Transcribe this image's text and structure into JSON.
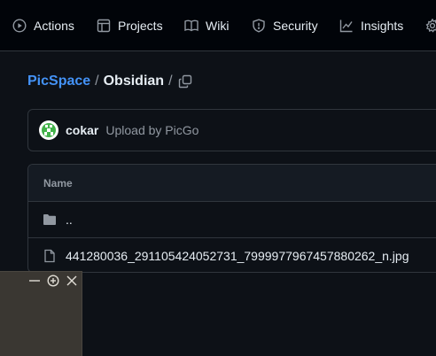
{
  "nav": {
    "items": [
      {
        "label": "Actions",
        "icon": "play-circle-icon"
      },
      {
        "label": "Projects",
        "icon": "table-icon"
      },
      {
        "label": "Wiki",
        "icon": "book-icon"
      },
      {
        "label": "Security",
        "icon": "shield-icon"
      },
      {
        "label": "Insights",
        "icon": "graph-icon"
      },
      {
        "label": "",
        "icon": "gear-icon"
      }
    ]
  },
  "breadcrumb": {
    "repo": "PicSpace",
    "separator": "/",
    "current": "Obsidian",
    "trailing_separator": "/"
  },
  "commit": {
    "user": "cokar",
    "message": "Upload by PicGo"
  },
  "file_table": {
    "header": "Name",
    "rows": [
      {
        "type": "directory",
        "name": ".."
      },
      {
        "type": "file",
        "name": "441280036_291105424052731_7999977967457880262_n.jpg"
      }
    ]
  },
  "overlay": {
    "buttons": [
      "minimize-icon",
      "zoom-in-icon",
      "close-icon"
    ]
  },
  "colors": {
    "page_bg": "#0d1117",
    "nav_bg": "#010409",
    "link": "#4493f8",
    "border": "#30363d",
    "muted_text": "#9198a1",
    "overlay_bg": "#3a3732"
  }
}
